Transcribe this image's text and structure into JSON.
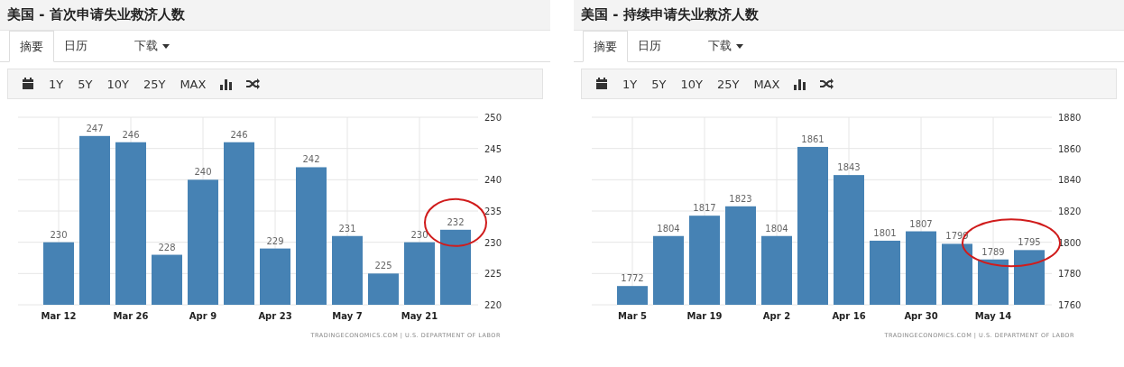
{
  "panels": [
    {
      "title": "美国 - 首次申请失业救济人数",
      "tabs": [
        {
          "label": "摘要",
          "selected": true,
          "kind": "tab"
        },
        {
          "label": "日历",
          "selected": false,
          "kind": "tab"
        },
        {
          "label": "下载",
          "selected": false,
          "kind": "dropdown"
        }
      ],
      "toolbar": [
        {
          "kind": "calendar"
        },
        {
          "kind": "text",
          "label": "1Y"
        },
        {
          "kind": "text",
          "label": "5Y"
        },
        {
          "kind": "text",
          "label": "10Y"
        },
        {
          "kind": "text",
          "label": "25Y"
        },
        {
          "kind": "text",
          "label": "MAX"
        },
        {
          "kind": "bars"
        },
        {
          "kind": "shuffle"
        }
      ],
      "chart_data": {
        "type": "bar",
        "values": [
          230,
          247,
          246,
          228,
          240,
          246,
          229,
          242,
          231,
          225,
          230,
          232
        ],
        "categories": [
          "Mar 12",
          null,
          "Mar 26",
          null,
          "Apr 9",
          null,
          "Apr 23",
          null,
          "May 7",
          null,
          "May 21",
          null
        ],
        "ylim": [
          220,
          250
        ],
        "yticks": [
          220,
          225,
          230,
          235,
          240,
          245,
          250
        ],
        "data_labels": true,
        "grid": true
      },
      "circled_bars": [
        false,
        false,
        false,
        false,
        false,
        false,
        false,
        false,
        false,
        false,
        false,
        true
      ],
      "source": "TRADINGECONOMICS.COM | U.S. DEPARTMENT OF LABOR"
    },
    {
      "title": "美国 - 持续申请失业救济人数",
      "tabs": [
        {
          "label": "摘要",
          "selected": true,
          "kind": "tab"
        },
        {
          "label": "日历",
          "selected": false,
          "kind": "tab"
        },
        {
          "label": "下载",
          "selected": false,
          "kind": "dropdown"
        }
      ],
      "toolbar": [
        {
          "kind": "calendar"
        },
        {
          "kind": "text",
          "label": "1Y"
        },
        {
          "kind": "text",
          "label": "5Y"
        },
        {
          "kind": "text",
          "label": "10Y"
        },
        {
          "kind": "text",
          "label": "25Y"
        },
        {
          "kind": "text",
          "label": "MAX"
        },
        {
          "kind": "bars"
        },
        {
          "kind": "shuffle"
        }
      ],
      "chart_data": {
        "type": "bar",
        "values": [
          1772,
          1804,
          1817,
          1823,
          1804,
          1861,
          1843,
          1801,
          1807,
          1799,
          1789,
          1795
        ],
        "categories": [
          "Mar 5",
          null,
          "Mar 19",
          null,
          "Apr 2",
          null,
          "Apr 16",
          null,
          "Apr 30",
          null,
          "May 14",
          null
        ],
        "ylim": [
          1760,
          1880
        ],
        "yticks": [
          1760,
          1780,
          1800,
          1820,
          1840,
          1860,
          1880
        ],
        "data_labels": true,
        "grid": true
      },
      "circled_bars": [
        false,
        false,
        false,
        false,
        false,
        false,
        false,
        false,
        false,
        false,
        true,
        true
      ],
      "source": "TRADINGECONOMICS.COM | U.S. DEPARTMENT OF LABOR"
    }
  ]
}
